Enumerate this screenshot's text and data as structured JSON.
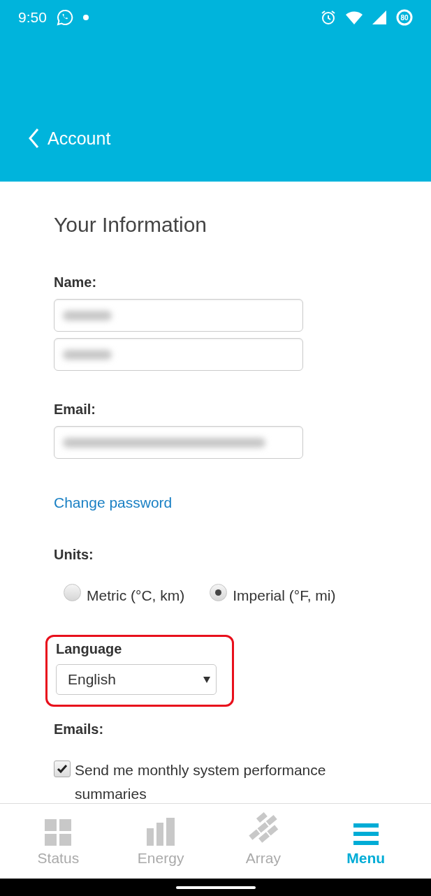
{
  "status_bar": {
    "time": "9:50",
    "battery": "80"
  },
  "header": {
    "back_label": "Account"
  },
  "form": {
    "title": "Your Information",
    "name_label": "Name:",
    "name_fields": [
      {
        "blurred": true
      },
      {
        "blurred": true
      }
    ],
    "email_label": "Email:",
    "email_field": {
      "blurred": true
    },
    "change_password": "Change password",
    "units_label": "Units:",
    "units": [
      {
        "label": "Metric (°C, km)",
        "selected": false
      },
      {
        "label": "Imperial (°F, mi)",
        "selected": true
      }
    ],
    "language": {
      "label": "Language",
      "value": "English",
      "highlighted": true
    },
    "emails_label": "Emails:",
    "email_options": [
      {
        "label": "Send me monthly system performance summaries",
        "checked": true
      }
    ]
  },
  "bottom_nav": [
    {
      "label": "Status",
      "selected": false
    },
    {
      "label": "Energy",
      "selected": false
    },
    {
      "label": "Array",
      "selected": false
    },
    {
      "label": "Menu",
      "selected": true
    }
  ]
}
